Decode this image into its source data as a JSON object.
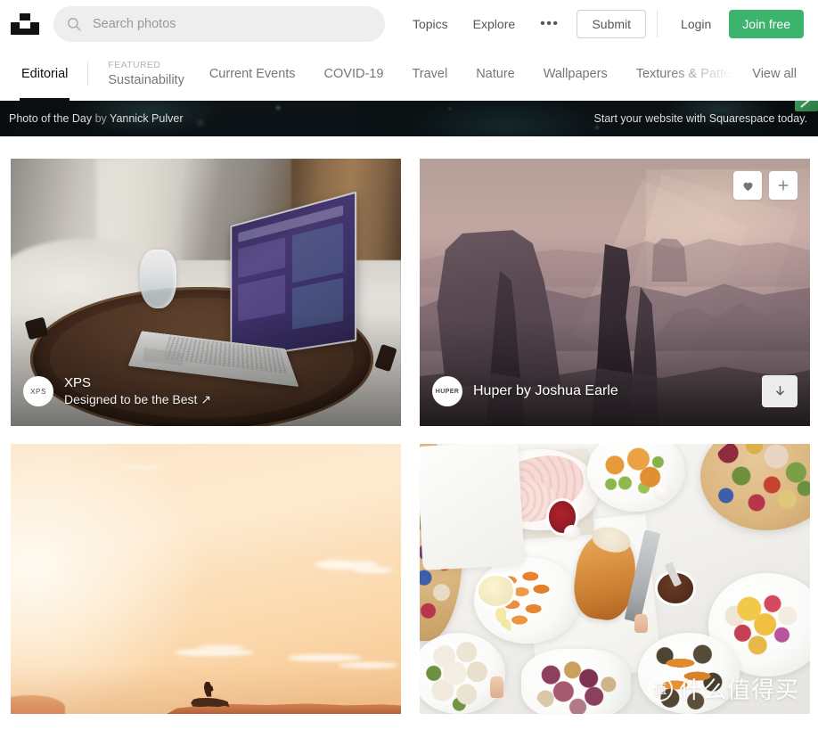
{
  "header": {
    "logo_name": "unsplash-logo",
    "search": {
      "placeholder": "Search photos",
      "value": "",
      "icon": "search-icon"
    },
    "nav": [
      {
        "label": "Topics"
      },
      {
        "label": "Explore"
      }
    ],
    "more_label": "•••",
    "submit_label": "Submit",
    "login_label": "Login",
    "join_label": "Join free",
    "join_color": "#3cb46e"
  },
  "category_nav": {
    "editorial_label": "Editorial",
    "featured_label": "FEATURED",
    "featured_name": "Sustainability",
    "items": [
      {
        "label": "Current Events"
      },
      {
        "label": "COVID-19"
      },
      {
        "label": "Travel"
      },
      {
        "label": "Nature"
      },
      {
        "label": "Wallpapers"
      },
      {
        "label": "Textures & Patterns"
      }
    ],
    "view_all_label": "View all"
  },
  "banner": {
    "left_prefix": "Photo of the Day",
    "left_by": " by ",
    "left_author": "Yannick Pulver",
    "right_text": "Start your website with Squarespace today.",
    "badge_name": "sponsor-badge"
  },
  "photos": [
    {
      "id": "photo-xps",
      "brand_badge": "XPS",
      "title": "XPS",
      "subtitle": "Designed to be the Best ↗",
      "alt": "Laptop and glass of water on a round wooden tray on a bed"
    },
    {
      "id": "photo-huper",
      "brand_badge": "HUPER",
      "caption": "Huper by Joshua Earle",
      "alt": "Silhouetted canyon rock spires in hazy pink light",
      "like_icon": "heart-icon",
      "add_icon": "plus-icon",
      "download_icon": "download-arrow-icon"
    },
    {
      "id": "photo-sunset",
      "alt": "Horse rider silhouette against a golden desert sunset sky"
    },
    {
      "id": "photo-food",
      "alt": "Overhead flat-lay of a festive food spread on a white table",
      "watermark_mark": "值",
      "watermark_text": "什么值得买"
    }
  ]
}
